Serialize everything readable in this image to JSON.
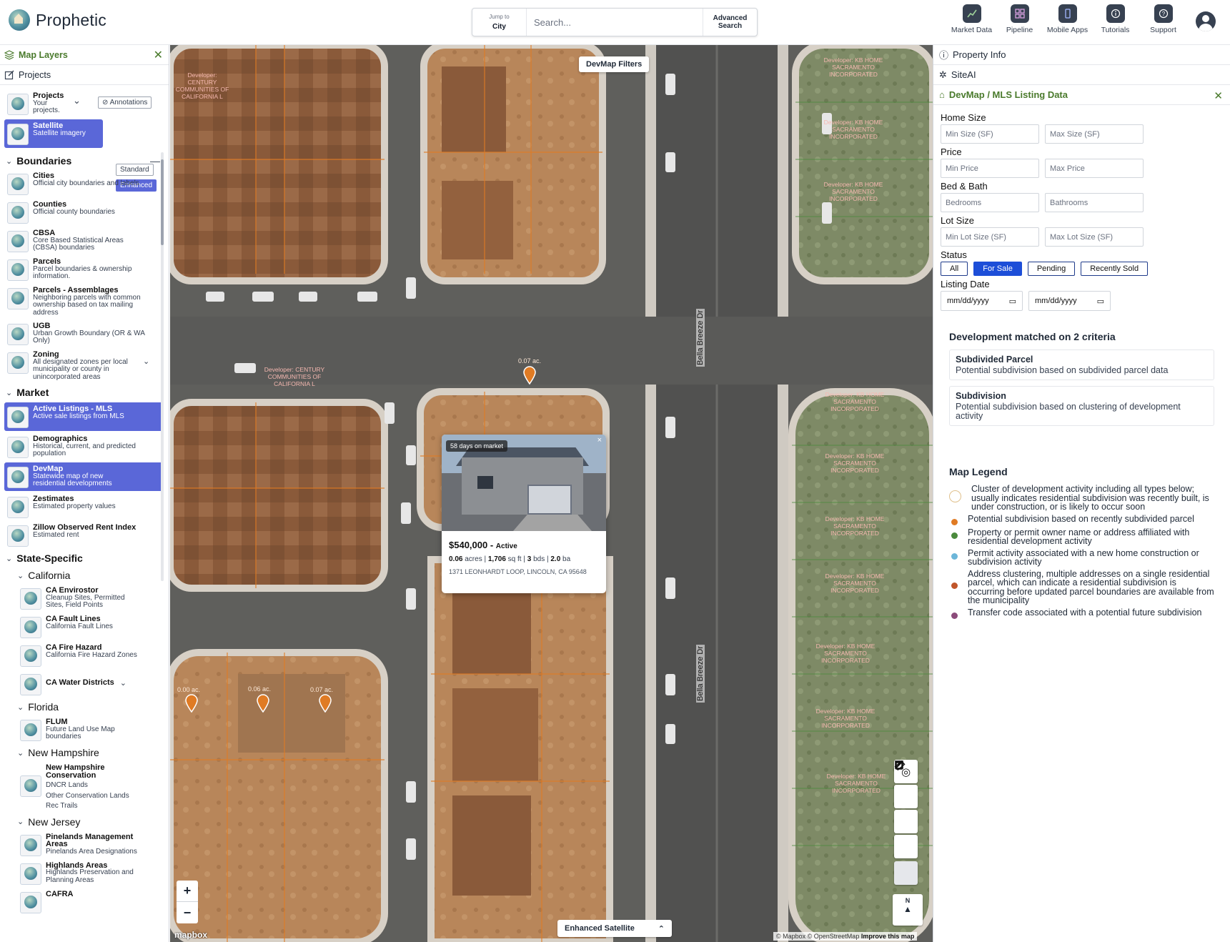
{
  "header": {
    "app_name": "Prophetic",
    "jump_to_label": "Jump to",
    "jump_to_value": "City",
    "search_placeholder": "Search...",
    "advanced_search_line1": "Advanced",
    "advanced_search_line2": "Search",
    "nav": [
      {
        "label": "Market Data",
        "icon": "chart-icon"
      },
      {
        "label": "Pipeline",
        "icon": "grid-icon"
      },
      {
        "label": "Mobile Apps",
        "icon": "phone-icon"
      },
      {
        "label": "Tutorials",
        "icon": "info-icon"
      },
      {
        "label": "Support",
        "icon": "help-icon"
      }
    ]
  },
  "sidebar": {
    "map_layers": "Map Layers",
    "projects_header": "Projects",
    "projects_layer": {
      "name": "Projects",
      "desc": "Your projects."
    },
    "annotations": "Annotations",
    "satellite": {
      "name": "Satellite",
      "desc": "Satellite imagery",
      "opt1": "Standard",
      "opt2": "Enhanced"
    },
    "boundaries": {
      "title": "Boundaries",
      "items": [
        {
          "name": "Cities",
          "desc": "Official city boundaries and labels"
        },
        {
          "name": "Counties",
          "desc": "Official county boundaries"
        },
        {
          "name": "CBSA",
          "desc": "Core Based Statistical Areas (CBSA) boundaries"
        },
        {
          "name": "Parcels",
          "desc": "Parcel boundaries & ownership information."
        },
        {
          "name": "Parcels - Assemblages",
          "desc": "Neighboring parcels with common ownership based on tax mailing address"
        },
        {
          "name": "UGB",
          "desc": "Urban Growth Boundary (OR & WA Only)"
        },
        {
          "name": "Zoning",
          "desc": "All designated zones per local municipality or county in unincorporated areas"
        }
      ]
    },
    "market": {
      "title": "Market",
      "items": [
        {
          "name": "Active Listings - MLS",
          "desc": "Active sale listings from MLS"
        },
        {
          "name": "Demographics",
          "desc": "Historical, current, and predicted population"
        },
        {
          "name": "DevMap",
          "desc": "Statewide map of new residential developments"
        },
        {
          "name": "Zestimates",
          "desc": "Estimated property values"
        },
        {
          "name": "Zillow Observed Rent Index",
          "desc": "Estimated rent"
        }
      ]
    },
    "state_specific": {
      "title": "State-Specific",
      "california": "California",
      "ca_items": [
        {
          "name": "CA Envirostor",
          "desc": "Cleanup Sites, Permitted Sites, Field Points"
        },
        {
          "name": "CA Fault Lines",
          "desc": "California Fault Lines"
        },
        {
          "name": "CA Fire Hazard",
          "desc": "California Fire Hazard Zones"
        },
        {
          "name": "CA Water Districts",
          "desc": ""
        }
      ],
      "florida": "Florida",
      "fl_items": [
        {
          "name": "FLUM",
          "desc": "Future Land Use Map boundaries"
        }
      ],
      "new_hampshire": "New Hampshire",
      "nh_item": {
        "name": "New Hampshire Conservation",
        "sub1": "DNCR Lands",
        "sub2": "Other Conservation Lands",
        "sub3": "Rec Trails"
      },
      "new_jersey": "New Jersey",
      "nj_items": [
        {
          "name": "Pinelands Management Areas",
          "desc": "Pinelands Area Designations"
        },
        {
          "name": "Highlands Areas",
          "desc": "Highlands Preservation and Planning Areas"
        },
        {
          "name": "CAFRA",
          "desc": ""
        }
      ]
    }
  },
  "map": {
    "devmap_filters": "DevMap Filters",
    "street_1": "Bella Breeze Dr",
    "street_2": "Bella Breeze Dr",
    "developer_century": "Developer: CENTURY COMMUNITIES OF CALIFORNIA L",
    "developer_kb": "Developer: KB HOME SACRAMENTO INCORPORATED",
    "parcel_labels": [
      "0.07 ac.",
      "0.00 ac.",
      "0.06 ac.",
      "0.07 ac."
    ],
    "popup": {
      "days_on_market": "58 days on market",
      "close": "×",
      "price": "$540,000 - ",
      "status": "Active",
      "acres": "0.06",
      "acres_unit": " acres | ",
      "sqft": "1,706",
      "sqft_unit": " sq ft | ",
      "beds": "3",
      "beds_unit": " bds | ",
      "baths": "2.0",
      "baths_unit": " ba",
      "address": "1371 LEONHARDT LOOP, LINCOLN, CA 95648"
    },
    "basemap_selector": "Enhanced Satellite",
    "zoom_in": "+",
    "zoom_out": "−",
    "compass": "N",
    "mapbox": "mapbox",
    "attribution": "© Mapbox © OpenStreetMap",
    "improve": "Improve this map"
  },
  "right_panel": {
    "property_info": "Property Info",
    "siteai": "SiteAI",
    "devmap_listing": "DevMap / MLS Listing Data",
    "home_size": "Home Size",
    "min_size": "Min Size (SF)",
    "max_size": "Max Size (SF)",
    "price": "Price",
    "min_price": "Min Price",
    "max_price": "Max Price",
    "bed_bath": "Bed & Bath",
    "bedrooms": "Bedrooms",
    "bathrooms": "Bathrooms",
    "lot_size": "Lot Size",
    "min_lot": "Min Lot Size (SF)",
    "max_lot": "Max Lot Size (SF)",
    "status": "Status",
    "status_options": [
      "All",
      "For Sale",
      "Pending",
      "Recently Sold"
    ],
    "status_selected": "For Sale",
    "listing_date": "Listing Date",
    "date_placeholder": "mm/dd/yyyy",
    "matched_title": "Development matched on 2 criteria",
    "criteria": [
      {
        "name": "Subdivided Parcel",
        "desc": "Potential subdivision based on subdivided parcel data"
      },
      {
        "name": "Subdivision",
        "desc": "Potential subdivision based on clustering of development activity"
      }
    ],
    "legend_title": "Map Legend",
    "legend": [
      {
        "color": "#e0c08c",
        "text": "Cluster of development activity including all types below; usually indicates residential subdivision was recently built, is under construction, or is likely to occur soon"
      },
      {
        "color": "#e07b24",
        "text": "Potential subdivision based on recently subdivided parcel"
      },
      {
        "color": "#4a8a3c",
        "text": "Property or permit owner name or address affiliated with residential development activity"
      },
      {
        "color": "#6cb6d9",
        "text": "Permit activity associated with a new home construction or subdivision activity"
      },
      {
        "color": "#c0552a",
        "text": "Address clustering, multiple addresses on a single residential parcel, which can indicate a residential subdivision is occurring before updated parcel boundaries are available from the municipality"
      },
      {
        "color": "#8b4b7a",
        "text": "Transfer code associated with a potential future subdivision"
      }
    ]
  }
}
